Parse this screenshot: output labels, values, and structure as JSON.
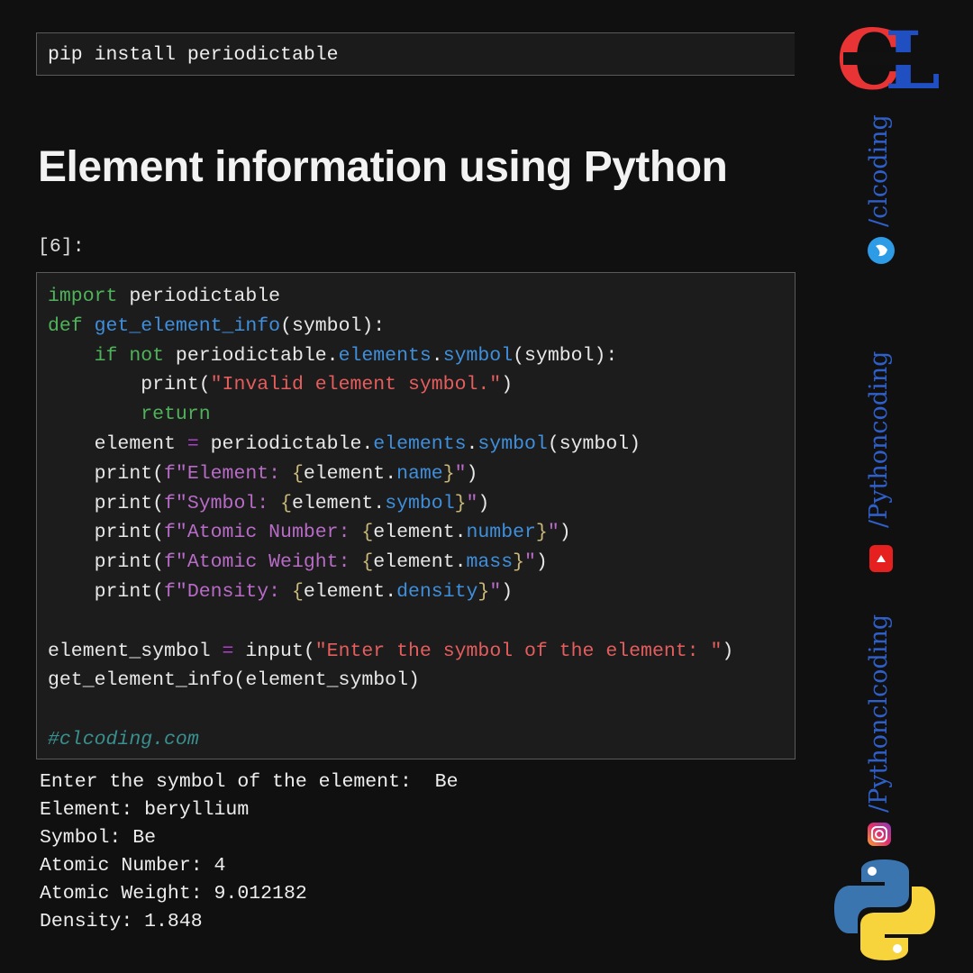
{
  "pip_command": "pip install periodictable",
  "title": "Element information using Python",
  "cell_prompt": "[6]:",
  "code_lines": [
    [
      {
        "t": "import",
        "c": "kw"
      },
      {
        "t": " periodictable",
        "c": ""
      }
    ],
    [
      {
        "t": "def",
        "c": "kw"
      },
      {
        "t": " ",
        "c": ""
      },
      {
        "t": "get_element_info",
        "c": "fn"
      },
      {
        "t": "(symbol):",
        "c": ""
      }
    ],
    [
      {
        "t": "    ",
        "c": ""
      },
      {
        "t": "if not",
        "c": "kw"
      },
      {
        "t": " periodictable.",
        "c": ""
      },
      {
        "t": "elements",
        "c": "fn"
      },
      {
        "t": ".",
        "c": ""
      },
      {
        "t": "symbol",
        "c": "fn"
      },
      {
        "t": "(symbol):",
        "c": ""
      }
    ],
    [
      {
        "t": "        print(",
        "c": ""
      },
      {
        "t": "\"Invalid element symbol.\"",
        "c": "str"
      },
      {
        "t": ")",
        "c": ""
      }
    ],
    [
      {
        "t": "        ",
        "c": ""
      },
      {
        "t": "return",
        "c": "kw"
      }
    ],
    [
      {
        "t": "    element ",
        "c": ""
      },
      {
        "t": "=",
        "c": "op"
      },
      {
        "t": " periodictable.",
        "c": ""
      },
      {
        "t": "elements",
        "c": "fn"
      },
      {
        "t": ".",
        "c": ""
      },
      {
        "t": "symbol",
        "c": "fn"
      },
      {
        "t": "(symbol)",
        "c": ""
      }
    ],
    [
      {
        "t": "    print(",
        "c": ""
      },
      {
        "t": "f\"Element: ",
        "c": "fs"
      },
      {
        "t": "{",
        "c": "br"
      },
      {
        "t": "element.",
        "c": ""
      },
      {
        "t": "name",
        "c": "fn"
      },
      {
        "t": "}",
        "c": "br"
      },
      {
        "t": "\"",
        "c": "fs"
      },
      {
        "t": ")",
        "c": ""
      }
    ],
    [
      {
        "t": "    print(",
        "c": ""
      },
      {
        "t": "f\"Symbol: ",
        "c": "fs"
      },
      {
        "t": "{",
        "c": "br"
      },
      {
        "t": "element.",
        "c": ""
      },
      {
        "t": "symbol",
        "c": "fn"
      },
      {
        "t": "}",
        "c": "br"
      },
      {
        "t": "\"",
        "c": "fs"
      },
      {
        "t": ")",
        "c": ""
      }
    ],
    [
      {
        "t": "    print(",
        "c": ""
      },
      {
        "t": "f\"Atomic Number: ",
        "c": "fs"
      },
      {
        "t": "{",
        "c": "br"
      },
      {
        "t": "element.",
        "c": ""
      },
      {
        "t": "number",
        "c": "fn"
      },
      {
        "t": "}",
        "c": "br"
      },
      {
        "t": "\"",
        "c": "fs"
      },
      {
        "t": ")",
        "c": ""
      }
    ],
    [
      {
        "t": "    print(",
        "c": ""
      },
      {
        "t": "f\"Atomic Weight: ",
        "c": "fs"
      },
      {
        "t": "{",
        "c": "br"
      },
      {
        "t": "element.",
        "c": ""
      },
      {
        "t": "mass",
        "c": "fn"
      },
      {
        "t": "}",
        "c": "br"
      },
      {
        "t": "\"",
        "c": "fs"
      },
      {
        "t": ")",
        "c": ""
      }
    ],
    [
      {
        "t": "    print(",
        "c": ""
      },
      {
        "t": "f\"Density: ",
        "c": "fs"
      },
      {
        "t": "{",
        "c": "br"
      },
      {
        "t": "element.",
        "c": ""
      },
      {
        "t": "density",
        "c": "fn"
      },
      {
        "t": "}",
        "c": "br"
      },
      {
        "t": "\"",
        "c": "fs"
      },
      {
        "t": ")",
        "c": ""
      }
    ],
    [],
    [
      {
        "t": "element_symbol ",
        "c": ""
      },
      {
        "t": "=",
        "c": "op"
      },
      {
        "t": " input(",
        "c": ""
      },
      {
        "t": "\"Enter the symbol of the element: \"",
        "c": "str"
      },
      {
        "t": ")",
        "c": ""
      }
    ],
    [
      {
        "t": "get_element_info(element_symbol)",
        "c": ""
      }
    ],
    [],
    [
      {
        "t": "#clcoding.com",
        "c": "cm"
      }
    ]
  ],
  "output_lines": [
    "Enter the symbol of the element:  Be",
    "Element: beryllium",
    "Symbol: Be",
    "Atomic Number: 4",
    "Atomic Weight: 9.012182",
    "Density: 1.848"
  ],
  "sidebar": {
    "logo_text": "CL",
    "handles": [
      {
        "text": "/clcoding",
        "icon": "twitter-icon"
      },
      {
        "text": "/Pythoncoding",
        "icon": "youtube-icon"
      },
      {
        "text": "/Pythonclcoding",
        "icon": "instagram-icon"
      }
    ]
  },
  "colors": {
    "keyword": "#4fb35a",
    "function": "#3f8fdc",
    "string": "#e55d5d",
    "fstring": "#b86bc7",
    "handle": "#2f5fc9"
  }
}
